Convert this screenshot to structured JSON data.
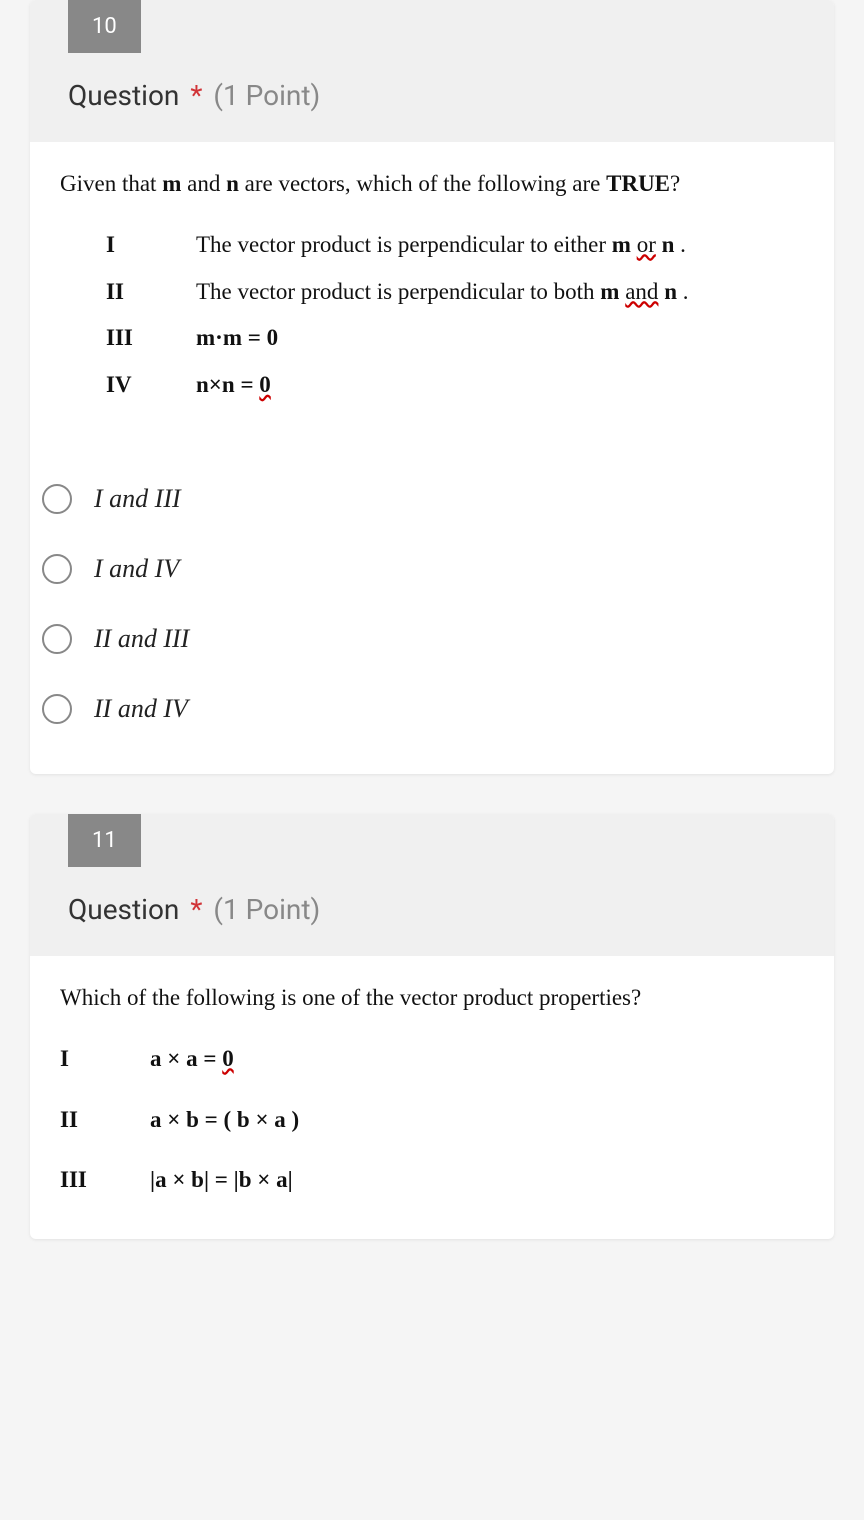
{
  "q10": {
    "number": "10",
    "title": "Question",
    "required_marker": "*",
    "points_label": "(1 Point)",
    "stem_prefix": "Given that ",
    "stem_m": "m",
    "stem_mid1": " and ",
    "stem_n": "n",
    "stem_suffix": " are vectors, which of the following are ",
    "stem_true": "TRUE",
    "stem_qmark": "?",
    "defs": [
      {
        "roman": "I",
        "pre": "The vector product is perpendicular to either ",
        "b1": "m",
        "mid": " ",
        "squig": "or",
        "sp": " ",
        "b2": "n",
        "post": " ."
      },
      {
        "roman": "II",
        "pre": "The vector product is perpendicular to both ",
        "b1": "m",
        "mid": " ",
        "squig": "and",
        "sp": " ",
        "b2": "n",
        "post": " ."
      },
      {
        "roman": "III",
        "math": "m·m = 0"
      },
      {
        "roman": "IV",
        "math_pre": "n×n = ",
        "math_zero": "0"
      }
    ],
    "options": [
      {
        "label": "I and III"
      },
      {
        "label": "I and IV"
      },
      {
        "label": "II and III"
      },
      {
        "label": "II and IV"
      }
    ]
  },
  "q11": {
    "number": "11",
    "title": "Question",
    "required_marker": "*",
    "points_label": "(1 Point)",
    "stem": "Which of the following is one of the vector product properties?",
    "defs": [
      {
        "roman": "I",
        "math_pre": "a × a  =  ",
        "math_zero": "0"
      },
      {
        "roman": "II",
        "math": "a × b  =  ( b × a )"
      },
      {
        "roman": "III",
        "math": "|a × b| = |b × a|"
      }
    ]
  }
}
